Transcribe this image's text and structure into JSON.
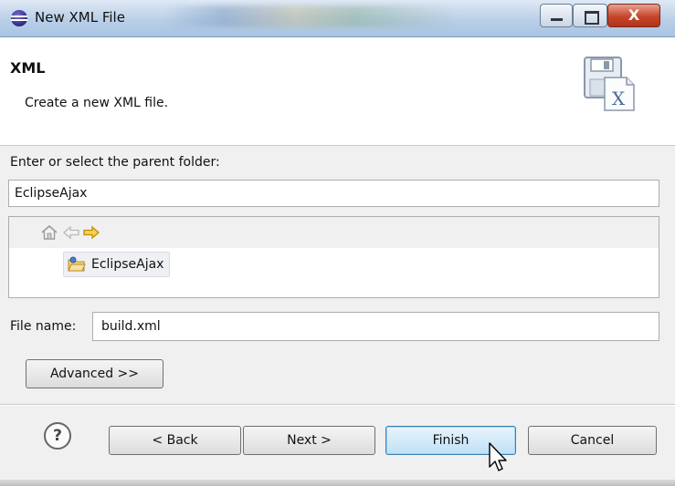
{
  "window": {
    "title": "New XML File",
    "close_glyph": "X"
  },
  "header": {
    "title": "XML",
    "description": "Create a new XML file."
  },
  "form": {
    "folder_label": "Enter or select the parent folder:",
    "folder_value": "EclipseAjax",
    "tree_items": [
      {
        "label": "EclipseAjax",
        "icon": "project-folder-icon"
      }
    ],
    "filename_label": "File name:",
    "filename_value": "build.xml"
  },
  "buttons": {
    "advanced": "Advanced >>",
    "help_glyph": "?",
    "back": "< Back",
    "next": "Next >",
    "finish": "Finish",
    "cancel": "Cancel"
  },
  "colors": {
    "title_bar": "#b9cfe7",
    "finish_button": "#bfe0f6",
    "close_button": "#c6462c"
  }
}
